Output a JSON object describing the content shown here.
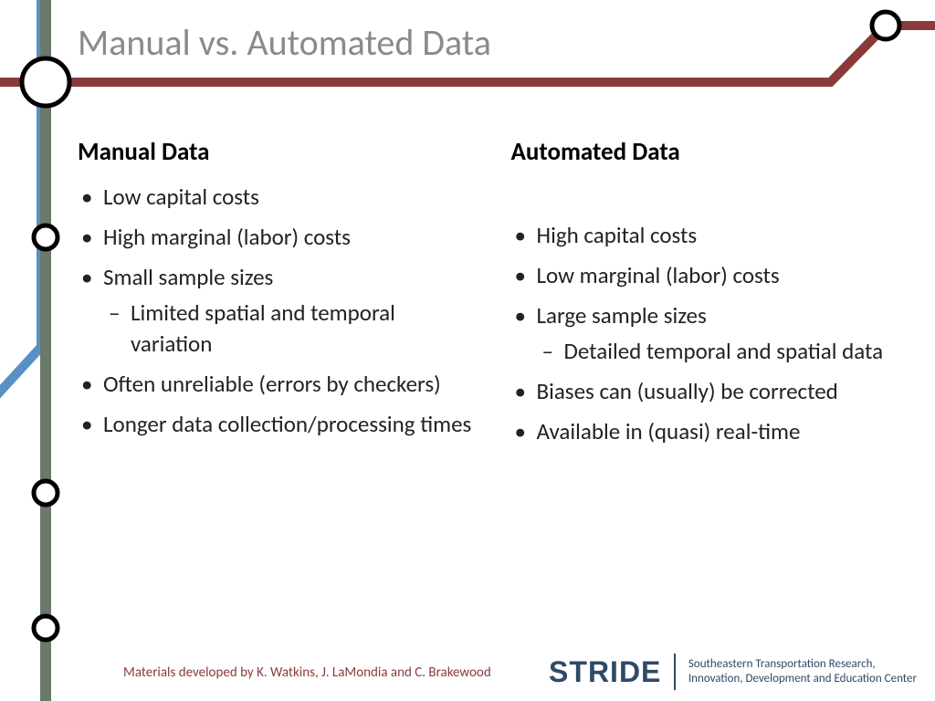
{
  "title": "Manual vs. Automated Data",
  "left": {
    "heading": "Manual Data",
    "b1": "Low capital costs",
    "b2": "High marginal (labor) costs",
    "b3": "Small sample sizes",
    "b3a": "Limited spatial and temporal variation",
    "b4": "Often unreliable (errors by checkers)",
    "b5": "Longer data collection/processing times"
  },
  "right": {
    "heading": "Automated Data",
    "b1": "High capital costs",
    "b2": "Low marginal (labor) costs",
    "b3": "Large sample sizes",
    "b3a": "Detailed temporal and spatial data",
    "b4": "Biases can (usually) be corrected",
    "b5": "Available in (quasi) real-time"
  },
  "footer": "Materials developed by K. Watkins, J. LaMondia and C. Brakewood",
  "logo": {
    "word": "STRIDE",
    "line1": "Southeastern Transportation Research,",
    "line2": "Innovation, Development and Education Center"
  }
}
